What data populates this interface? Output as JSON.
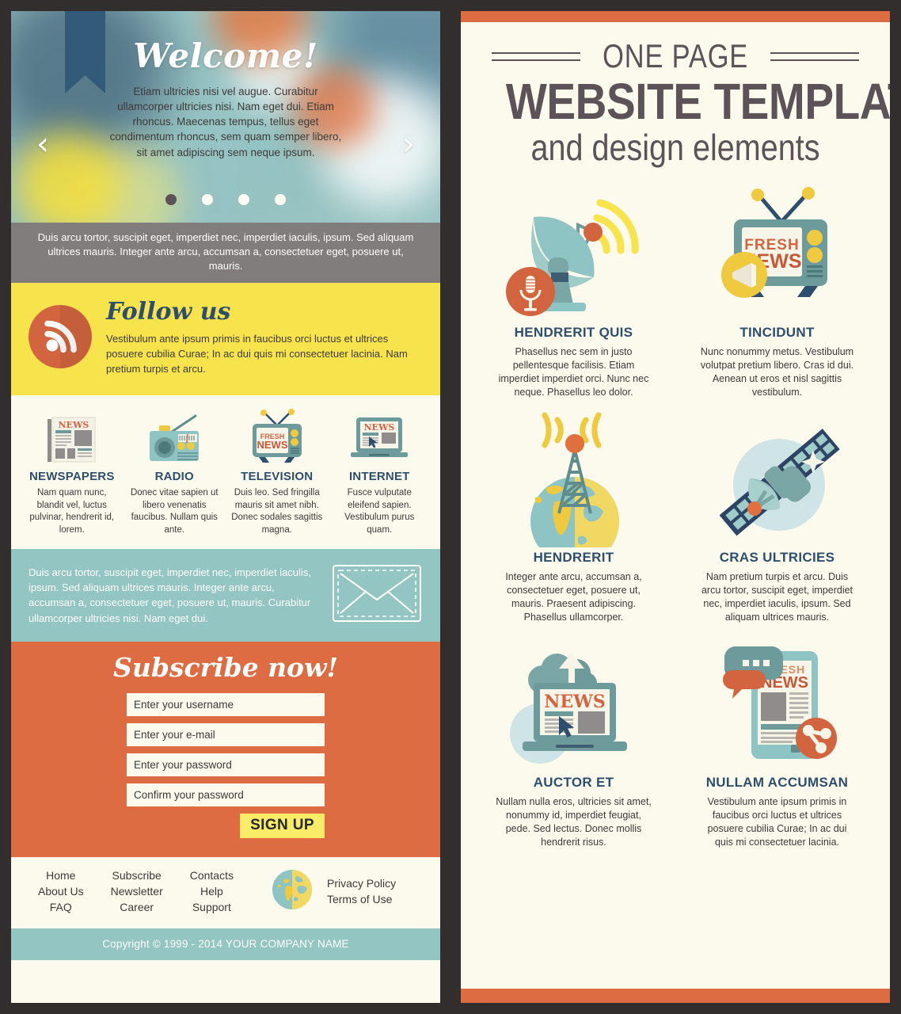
{
  "colors": {
    "frame": "#332e2e",
    "paper": "#fbfaec",
    "orange": "#dd6c42",
    "yellow": "#f7e34c",
    "teal": "#93c5c2",
    "navy": "#2d4f6d",
    "gray": "#807d7c",
    "charcoal": "#5b5358"
  },
  "left": {
    "hero": {
      "title": "Welcome!",
      "text": "Etiam ultricies nisi vel augue. Curabitur ullamcorper ultricies nisi. Nam eget dui. Etiam rhoncus. Maecenas tempus, tellus eget condimentum rhoncus, sem quam semper libero, sit amet adipiscing sem neque ipsum.",
      "prev_arrow": "‹",
      "next_arrow": "›",
      "dots_count": 4,
      "active_dot": 0
    },
    "gray_strip": {
      "text": "Duis arcu tortor, suscipit eget, imperdiet nec, imperdiet iaculis, ipsum. Sed aliquam ultrices mauris. Integer ante arcu, accumsan a, consectetuer eget, posuere ut, mauris."
    },
    "follow": {
      "title": "Follow us",
      "text": "Vestibulum ante ipsum primis in faucibus orci luctus et ultrices posuere cubilia Curae; In ac dui quis mi consectetuer lacinia. Nam pretium turpis et arcu.",
      "icon": "rss-icon"
    },
    "media": [
      {
        "icon": "newspaper-icon",
        "name": "NEWSPAPERS",
        "desc": "Nam quam nunc, blandit vel, luctus pulvinar, hendrerit id, lorem."
      },
      {
        "icon": "radio-icon",
        "name": "RADIO",
        "desc": "Donec vitae sapien ut libero venenatis faucibus. Nullam quis ante."
      },
      {
        "icon": "television-icon",
        "name": "TELEVISION",
        "desc": "Duis leo. Sed fringilla mauris sit amet nibh. Donec sodales sagittis magna."
      },
      {
        "icon": "laptop-icon",
        "name": "INTERNET",
        "desc": "Fusce vulputate eleifend sapien. Vestibulum purus quam."
      }
    ],
    "newsletter": {
      "text": "Duis arcu tortor, suscipit eget, imperdiet nec, imperdiet iaculis, ipsum. Sed aliquam ultrices mauris. Integer ante arcu, accumsan a, consectetuer eget, posuere ut, mauris. Curabitur ullamcorper ultricies nisi. Nam eget dui.",
      "icon": "envelope-icon"
    },
    "subscribe": {
      "title": "Subscribe now!",
      "fields": [
        {
          "name": "username",
          "placeholder": "Enter your username",
          "value": ""
        },
        {
          "name": "email",
          "placeholder": "Enter your e-mail",
          "value": ""
        },
        {
          "name": "password",
          "placeholder": "Enter your password",
          "value": ""
        },
        {
          "name": "confirm-password",
          "placeholder": "Confirm your password",
          "value": ""
        }
      ],
      "button_label": "SIGN UP"
    },
    "footer": {
      "col1": [
        "Home",
        "About Us",
        "FAQ"
      ],
      "col2": [
        "Subscribe",
        "Newsletter",
        "Career"
      ],
      "col3": [
        "Contacts",
        "Help",
        "Support"
      ],
      "globe_icon": "globe-icon",
      "legal": [
        "Privacy Policy",
        "Terms of Use"
      ],
      "copyright": "Copyright © 1999 - 2014 YOUR COMPANY NAME"
    }
  },
  "right": {
    "kicker": "ONE PAGE",
    "title": "WEBSITE TEMPLATE",
    "subtitle": "and design elements",
    "features": [
      {
        "icon": "satellite-dish-icon",
        "title": "HENDRERIT QUIS",
        "desc": "Phasellus nec sem in justo pellentesque facilisis. Etiam imperdiet imperdiet orci. Nunc nec neque. Phasellus leo dolor."
      },
      {
        "icon": "retro-tv-icon",
        "title": "TINCIDUNT",
        "desc": "Nunc nonummy metus. Vestibulum volutpat pretium libero. Cras id dui. Aenean ut eros et nisl sagittis vestibulum."
      },
      {
        "icon": "globe-antenna-icon",
        "title": "HENDRERIT",
        "desc": "Integer ante arcu, accumsan a, consectetuer eget, posuere ut, mauris. Praesent adipiscing. Phasellus ullamcorper."
      },
      {
        "icon": "satellite-icon",
        "title": "CRAS ULTRICIES",
        "desc": "Nam pretium turpis et arcu. Duis arcu tortor, suscipit eget, imperdiet nec, imperdiet iaculis, ipsum. Sed aliquam ultrices mauris."
      },
      {
        "icon": "laptop-cloud-icon",
        "title": "AUCTOR ET",
        "desc": "Nullam nulla eros, ultricies sit amet, nonummy id, imperdiet feugiat, pede. Sed lectus. Donec mollis hendrerit risus."
      },
      {
        "icon": "tablet-news-icon",
        "title": "NULLAM ACCUMSAN",
        "desc": "Vestibulum ante ipsum primis in faucibus orci luctus et ultrices posuere cubilia Curae; In ac dui quis mi consectetuer lacinia."
      }
    ]
  }
}
